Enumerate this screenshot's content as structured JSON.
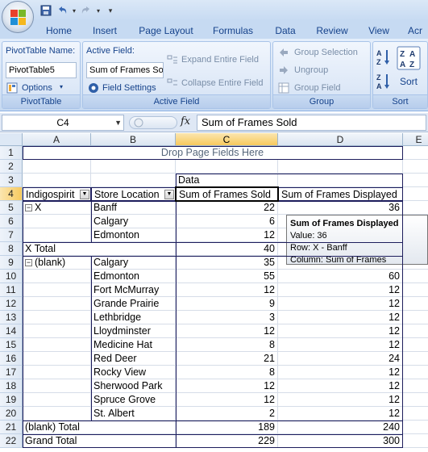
{
  "window": {
    "quick_access": [
      "save-icon",
      "undo-icon",
      "redo-icon",
      "customize-icon"
    ]
  },
  "tabs": [
    "Home",
    "Insert",
    "Page Layout",
    "Formulas",
    "Data",
    "Review",
    "View",
    "Acr"
  ],
  "ribbon": {
    "pivottable": {
      "name_label": "PivotTable Name:",
      "name_value": "PivotTable5",
      "options_label": "Options",
      "group_label": "PivotTable"
    },
    "active_field": {
      "label": "Active Field:",
      "value": "Sum of Frames So",
      "settings_label": "Field Settings",
      "expand_label": "Expand Entire Field",
      "collapse_label": "Collapse Entire Field",
      "group_label": "Active Field"
    },
    "group": {
      "selection_label": "Group Selection",
      "ungroup_label": "Ungroup",
      "field_label": "Group Field",
      "group_label": "Group"
    },
    "sort": {
      "sort_label": "Sort",
      "group_label": "Sort"
    }
  },
  "formula_bar": {
    "name_box": "C4",
    "fx": "fx",
    "formula": "Sum of Frames Sold"
  },
  "columns": [
    "A",
    "B",
    "C",
    "D",
    "E"
  ],
  "rows": [
    "1",
    "2",
    "3",
    "4",
    "5",
    "6",
    "7",
    "8",
    "9",
    "10",
    "11",
    "12",
    "13",
    "14",
    "15",
    "16",
    "17",
    "18",
    "19",
    "20",
    "21",
    "22"
  ],
  "sheet": {
    "drop_page_fields": "Drop Page Fields Here",
    "data_label": "Data",
    "headers": {
      "a": "Indigospirit",
      "b": "Store Location",
      "c": "Sum of Frames Sold",
      "d": "Sum of Frames Displayed"
    },
    "body": [
      {
        "a": "X",
        "b": "Banff",
        "c": "22",
        "d": "36",
        "expander": true
      },
      {
        "a": "",
        "b": "Calgary",
        "c": "6",
        "d": ""
      },
      {
        "a": "",
        "b": "Edmonton",
        "c": "12",
        "d": ""
      },
      {
        "a": "X Total",
        "b": "",
        "c": "40",
        "d": ""
      },
      {
        "a": "(blank)",
        "b": "Calgary",
        "c": "35",
        "d": "",
        "expander": true
      },
      {
        "a": "",
        "b": "Edmonton",
        "c": "55",
        "d": "60"
      },
      {
        "a": "",
        "b": "Fort McMurray",
        "c": "12",
        "d": "12"
      },
      {
        "a": "",
        "b": "Grande Prairie",
        "c": "9",
        "d": "12"
      },
      {
        "a": "",
        "b": "Lethbridge",
        "c": "3",
        "d": "12"
      },
      {
        "a": "",
        "b": "Lloydminster",
        "c": "12",
        "d": "12"
      },
      {
        "a": "",
        "b": "Medicine Hat",
        "c": "8",
        "d": "12"
      },
      {
        "a": "",
        "b": "Red Deer",
        "c": "21",
        "d": "24"
      },
      {
        "a": "",
        "b": "Rocky View",
        "c": "8",
        "d": "12"
      },
      {
        "a": "",
        "b": "Sherwood Park",
        "c": "12",
        "d": "12"
      },
      {
        "a": "",
        "b": "Spruce Grove",
        "c": "12",
        "d": "12"
      },
      {
        "a": "",
        "b": "St. Albert",
        "c": "2",
        "d": "12"
      },
      {
        "a": "(blank) Total",
        "b": "",
        "c": "189",
        "d": "240"
      },
      {
        "a": "Grand Total",
        "b": "",
        "c": "229",
        "d": "300"
      }
    ]
  },
  "tooltip": {
    "title": "Sum of Frames Displayed",
    "value": "Value: 36",
    "row": "Row: X - Banff",
    "column": "Column: Sum of Frames Displayed"
  },
  "colors": {
    "ribbon_text": "#15428b",
    "pivot_border": "#1d1d5c",
    "selected_header": "#f7c95d"
  }
}
